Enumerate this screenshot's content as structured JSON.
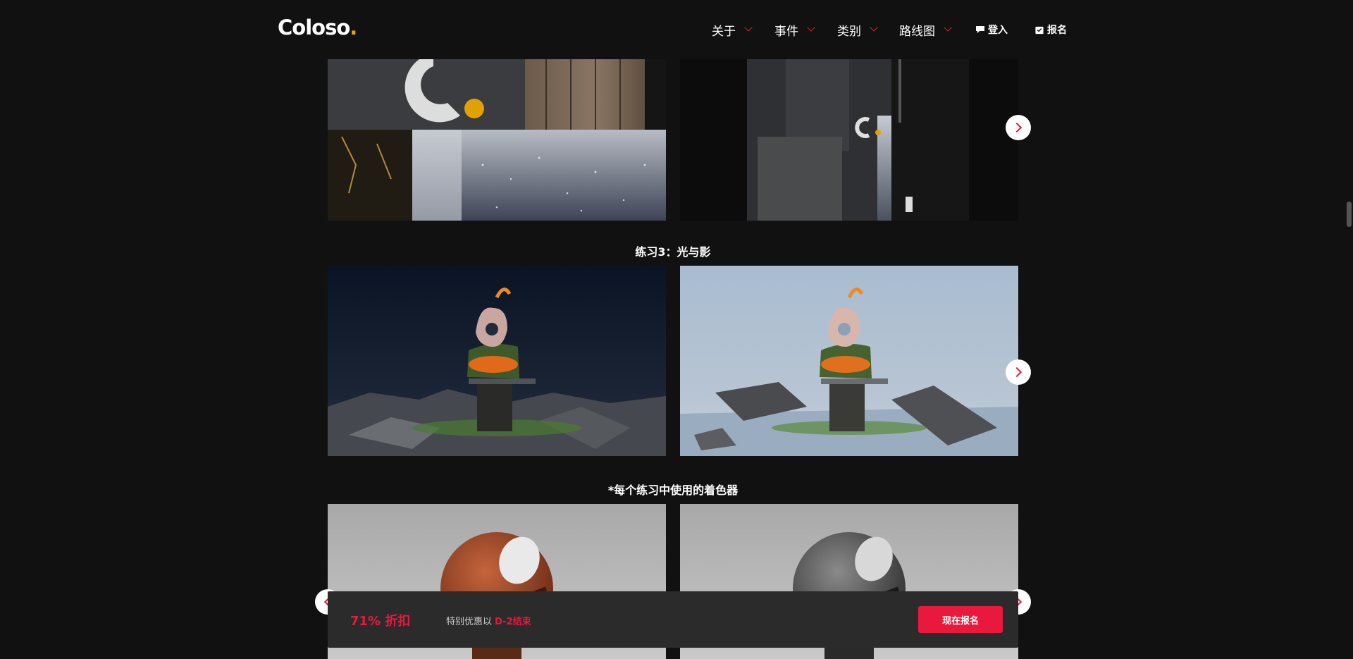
{
  "header": {
    "logo_text": "Coloso",
    "logo_dot": ".",
    "nav": [
      {
        "label": "关于"
      },
      {
        "label": "事件"
      },
      {
        "label": "类别"
      },
      {
        "label": "路线图"
      }
    ],
    "login_label": "登入",
    "signup_label": "报名"
  },
  "sections": {
    "exercise3_caption": "练习3：光与影",
    "shaders_caption": "*每个练习中使用的着色器"
  },
  "promo": {
    "discount": "71% 折扣",
    "text_prefix": "特别优惠以 ",
    "dday": "D-2结束",
    "cta_label": "现在报名"
  },
  "icons": {
    "chevron": "chevron-down-icon",
    "login": "chat-bubble-icon",
    "signup": "clipboard-icon",
    "carousel_next": "chevron-right-icon",
    "carousel_prev": "chevron-left-icon"
  },
  "colors": {
    "background": "#111111",
    "accent": "#e8193c",
    "logo_dot": "#f5a300",
    "promo_bar": "#2b2b2b"
  }
}
